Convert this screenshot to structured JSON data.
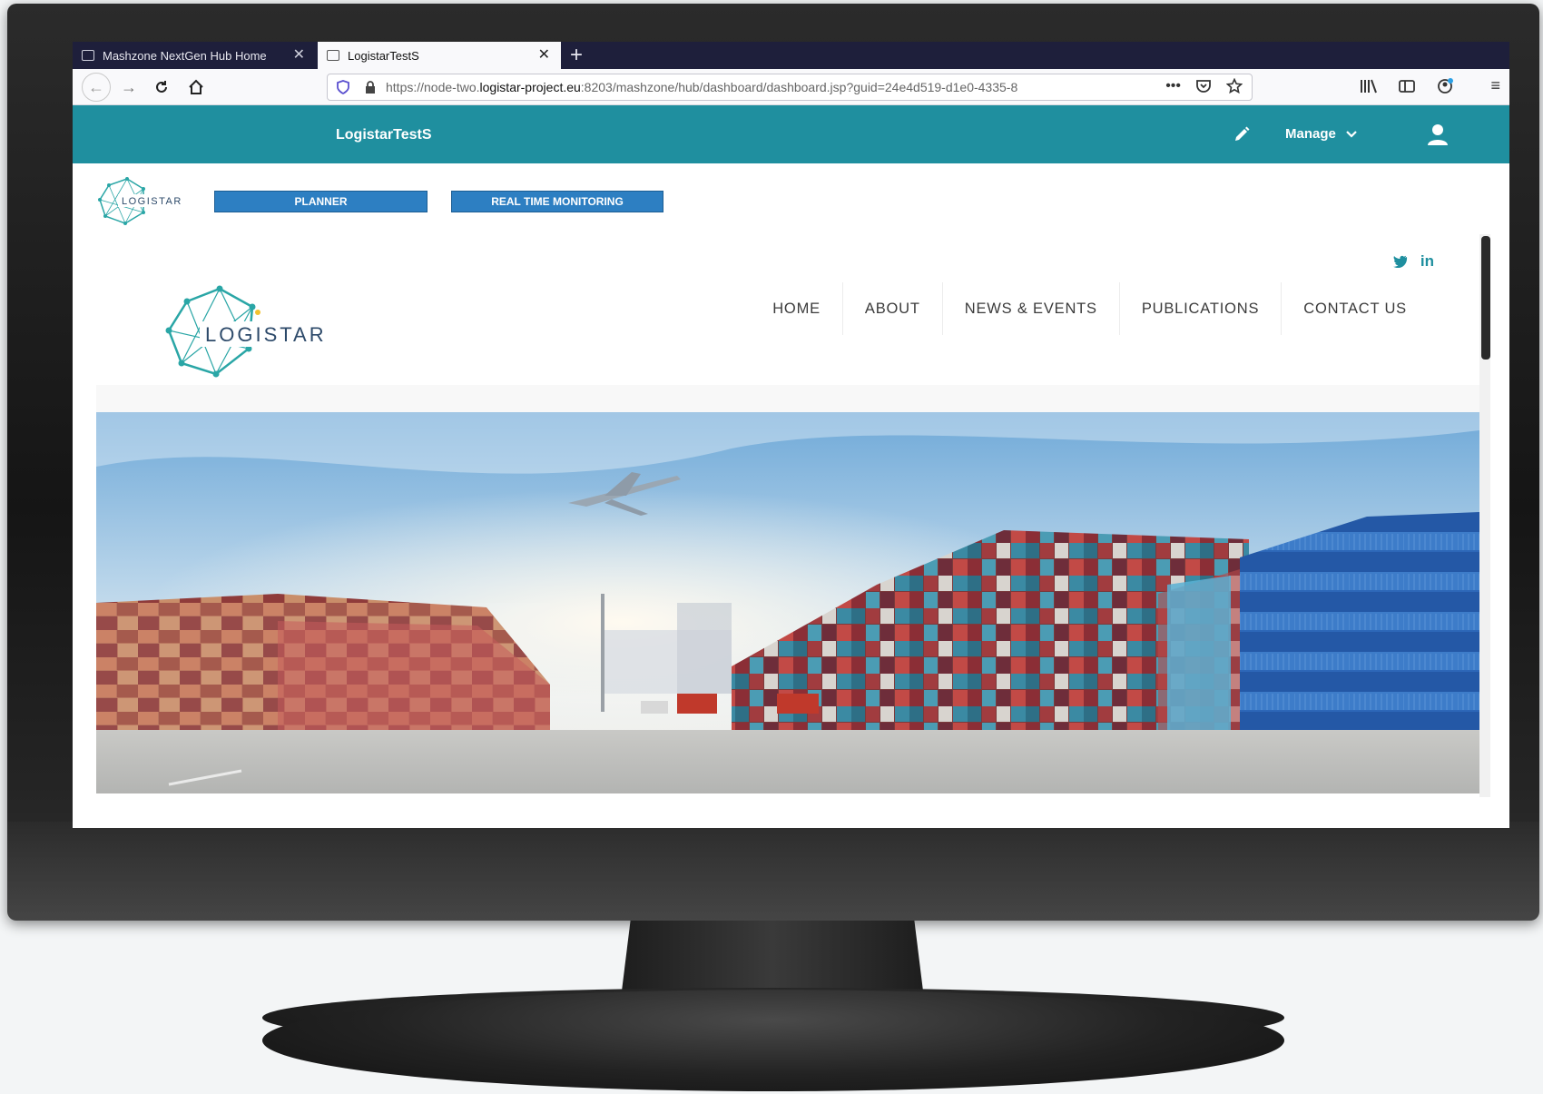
{
  "browser": {
    "tabs": [
      {
        "label": "Mashzone NextGen Hub Home"
      },
      {
        "label": "LogistarTestS"
      }
    ],
    "url_prefix": "https://node-two.",
    "url_host": "logistar-project.eu",
    "url_suffix": ":8203/mashzone/hub/dashboard/dashboard.jsp?guid=24e4d519-d1e0-4335-8"
  },
  "app": {
    "title": "LogistarTestS",
    "manage_label": "Manage",
    "accent_color": "#1f8f9f"
  },
  "toolbar": {
    "planner_label": "PLANNER",
    "rtm_label": "REAL TIME MONITORING",
    "small_logo_text": "LOGISTAR"
  },
  "site": {
    "logo_text": "LOGISTAR",
    "social": [
      "twitter-icon",
      "linkedin-icon"
    ],
    "linkedin_label": "in",
    "nav": [
      "HOME",
      "ABOUT",
      "NEWS & EVENTS",
      "PUBLICATIONS",
      "CONTACT US"
    ]
  }
}
